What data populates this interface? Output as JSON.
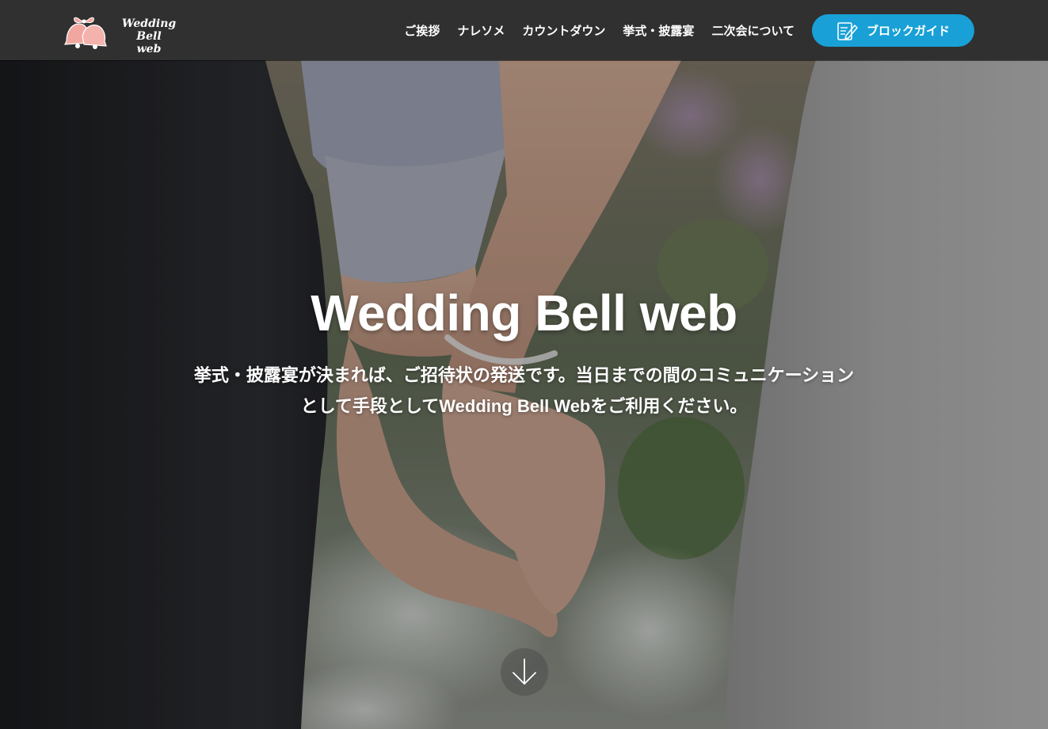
{
  "logo": {
    "text_line1": "Wedding Bell",
    "text_line2": "web",
    "icon": "wedding-bells-icon",
    "bell_color": "#f2a6a0"
  },
  "nav": {
    "items": [
      {
        "label": "ご挨拶"
      },
      {
        "label": "ナレソメ"
      },
      {
        "label": "カウントダウン"
      },
      {
        "label": "挙式・披露宴"
      },
      {
        "label": "二次会について"
      }
    ]
  },
  "guide_button": {
    "label": "ブロックガイド",
    "icon": "edit-note-icon",
    "color": "#19a0d7"
  },
  "hero": {
    "title": "Wedding Bell web",
    "subtitle_line1": "挙式・披露宴が決まれば、ご招待状の発送です。当日までの間のコミュニケーション",
    "subtitle_line2_pre": "として手段として",
    "subtitle_line2_brand": "Wedding Bell Web",
    "subtitle_line2_post": "をご利用ください。",
    "scroll_icon": "arrow-down-icon"
  }
}
